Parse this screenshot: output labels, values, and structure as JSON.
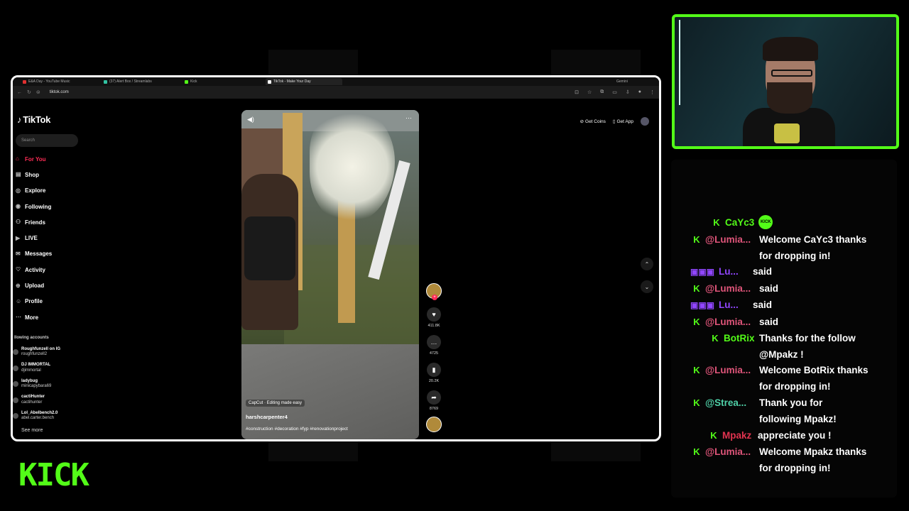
{
  "browser": {
    "tabs": [
      {
        "label": "E&A Day - YouTube Music",
        "color": "#e03030"
      },
      {
        "label": "(37) Alert Box / Streamlabs",
        "color": "#31c3a2"
      },
      {
        "label": "Kick",
        "color": "#53fc18"
      },
      {
        "label": "TikTok - Make Your Day",
        "color": "#ffffff",
        "active": true
      }
    ],
    "extra_tab": "Gemini",
    "url": "tiktok.com"
  },
  "tiktok": {
    "logo": "TikTok",
    "search_placeholder": "Search",
    "nav": [
      {
        "label": "For You",
        "icon": "home-icon",
        "active": true
      },
      {
        "label": "Shop",
        "icon": "shop-icon"
      },
      {
        "label": "Explore",
        "icon": "explore-icon"
      },
      {
        "label": "Following",
        "icon": "following-icon"
      },
      {
        "label": "Friends",
        "icon": "friends-icon"
      },
      {
        "label": "LIVE",
        "icon": "live-icon"
      },
      {
        "label": "Messages",
        "icon": "messages-icon"
      },
      {
        "label": "Activity",
        "icon": "activity-icon"
      },
      {
        "label": "Upload",
        "icon": "upload-icon"
      },
      {
        "label": "Profile",
        "icon": "profile-icon"
      },
      {
        "label": "More",
        "icon": "more-icon"
      }
    ],
    "following_header": "llowing accounts",
    "accounts": [
      {
        "name": "Roughfunzell on IG",
        "handle": "roughfunzell2"
      },
      {
        "name": "DJ IMMORTAL",
        "handle": "djimmortal"
      },
      {
        "name": "ladybug",
        "handle": "minicapybara69"
      },
      {
        "name": "cactiHunter",
        "handle": "cactihunter"
      },
      {
        "name": "Lol_Abelbench2.0",
        "handle": "abel.carter.bench"
      }
    ],
    "see_more": "See more",
    "top_right": {
      "get_coins": "Get Coins",
      "get_app": "Get App"
    },
    "video": {
      "capcut_label": "CapCut · Editing made easy",
      "author": "harshcarpenter4",
      "tags": "#construction #decoration #fyp #renovationproject"
    },
    "actions": {
      "likes": "411.8K",
      "comments": "4725",
      "saves": "20.2K",
      "shares": "8769"
    }
  },
  "chat": {
    "messages": [
      {
        "platform": "kick",
        "user": "CaYc3",
        "user_color": "#53fc18",
        "text": "",
        "badge": "KICK"
      },
      {
        "platform": "kick",
        "user": "@Lumia...",
        "user_color": "#e0557a",
        "text": "Welcome CaYc3 thanks for dropping in!"
      },
      {
        "platform": "twitch",
        "user": "Lu...",
        "user_color": "#9146ff",
        "text": "said"
      },
      {
        "platform": "kick",
        "user": "@Lumia...",
        "user_color": "#e0557a",
        "text": "said"
      },
      {
        "platform": "twitch",
        "user": "Lu...",
        "user_color": "#9146ff",
        "text": "said"
      },
      {
        "platform": "kick",
        "user": "@Lumia...",
        "user_color": "#e0557a",
        "text": "said"
      },
      {
        "platform": "kick",
        "user": "BotRix",
        "user_color": "#53fc18",
        "text": "Thanks for the follow @Mpakz !"
      },
      {
        "platform": "kick",
        "user": "@Lumia...",
        "user_color": "#e0557a",
        "text": "Welcome BotRix thanks for dropping in!"
      },
      {
        "platform": "kick",
        "user": "@Strea...",
        "user_color": "#4fd1a8",
        "text": "Thank you for following Mpakz!"
      },
      {
        "platform": "kick",
        "user": "Mpakz",
        "user_color": "#e0334f",
        "text": "appreciate you !"
      },
      {
        "platform": "kick",
        "user": "@Lumia...",
        "user_color": "#e0557a",
        "text": "Welcome Mpakz thanks for dropping in!"
      }
    ]
  },
  "overlay": {
    "kick_logo": "KICK"
  },
  "colors": {
    "kick_green": "#53fc18",
    "tiktok_red": "#fe2c55"
  }
}
